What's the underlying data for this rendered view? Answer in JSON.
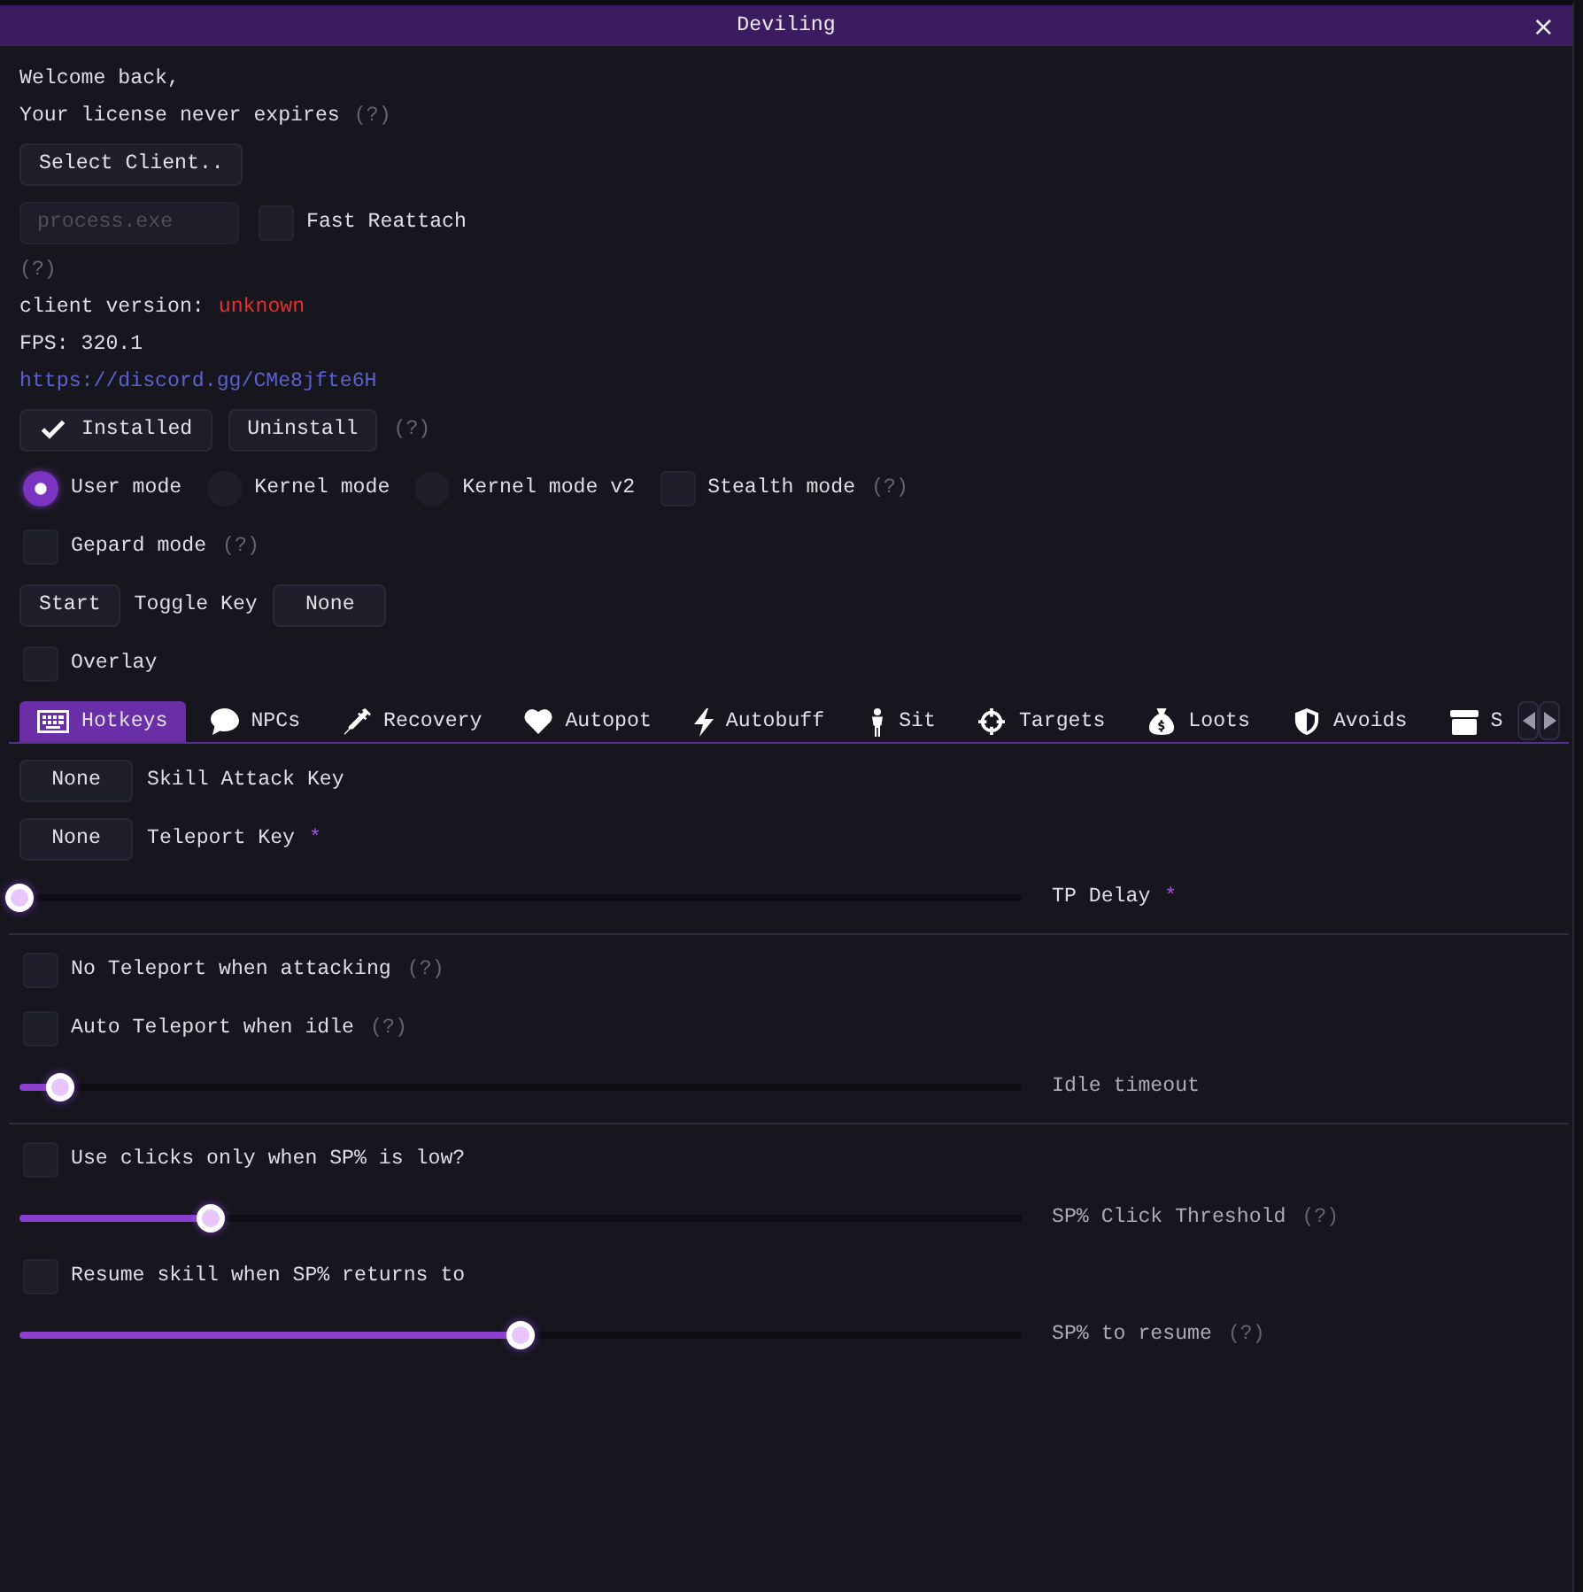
{
  "window": {
    "title": "Deviling",
    "close": "×"
  },
  "greeting": "Welcome back,",
  "license": {
    "text": "Your license never expires",
    "help": "(?)"
  },
  "select_client_button": "Select Client..",
  "process_field": {
    "placeholder": "process.exe"
  },
  "fast_reattach": {
    "label": "Fast Reattach",
    "checked": false
  },
  "process_help": "(?)",
  "client_version": {
    "label": "client version:",
    "value": "unknown"
  },
  "fps": "FPS: 320.1",
  "discord_link": "https://discord.gg/CMe8jfte6H",
  "install": {
    "status": {
      "label": "Installed",
      "checked": true
    },
    "uninstall": "Uninstall",
    "help": "(?)"
  },
  "modes": [
    {
      "kind": "radio",
      "label": "User mode",
      "selected": true
    },
    {
      "kind": "radio",
      "label": "Kernel mode",
      "selected": false
    },
    {
      "kind": "radio",
      "label": "Kernel mode v2",
      "selected": false
    },
    {
      "kind": "checkbox",
      "label": "Stealth mode",
      "checked": false,
      "help": "(?)"
    }
  ],
  "gepard": {
    "label": "Gepard mode",
    "checked": false,
    "help": "(?)"
  },
  "start_row": {
    "start": "Start",
    "toggle_label": "Toggle Key",
    "toggle_key": "None"
  },
  "overlay": {
    "label": "Overlay",
    "checked": false
  },
  "tabs": [
    {
      "label": "Hotkeys",
      "selected": true
    },
    {
      "label": "NPCs",
      "selected": false
    },
    {
      "label": "Recovery",
      "selected": false
    },
    {
      "label": "Autopot",
      "selected": false
    },
    {
      "label": "Autobuff",
      "selected": false
    },
    {
      "label": "Sit",
      "selected": false
    },
    {
      "label": "Targets",
      "selected": false
    },
    {
      "label": "Loots",
      "selected": false
    },
    {
      "label": "Avoids",
      "selected": false
    },
    {
      "label": "S",
      "selected": false
    }
  ],
  "hotkeys": {
    "rows": [
      {
        "kind": "key",
        "key": "None",
        "label": "Skill Attack Key"
      },
      {
        "kind": "key",
        "key": "None",
        "label": "Teleport Key",
        "mark": "*"
      },
      {
        "kind": "slider",
        "level": 0,
        "label": "TP Delay",
        "mark": "*",
        "disabled": false
      },
      {
        "kind": "separator"
      },
      {
        "kind": "checkbox",
        "label": "No Teleport when attacking",
        "checked": false,
        "help": "(?)"
      },
      {
        "kind": "checkbox",
        "label": "Auto Teleport when idle",
        "checked": false,
        "help": "(?)"
      },
      {
        "kind": "slider",
        "level": 0.04,
        "label": "Idle timeout",
        "disabled": true
      },
      {
        "kind": "separator"
      },
      {
        "kind": "checkbox",
        "label": "Use clicks only when SP% is low?",
        "checked": false
      },
      {
        "kind": "slider",
        "level": 0.19,
        "label": "SP% Click Threshold",
        "help": "(?)",
        "disabled": true
      },
      {
        "kind": "checkbox",
        "label": "Resume skill when SP% returns to",
        "checked": false
      },
      {
        "kind": "slider",
        "level": 0.5,
        "label": "SP% to resume",
        "help": "(?)",
        "disabled": true
      }
    ]
  }
}
